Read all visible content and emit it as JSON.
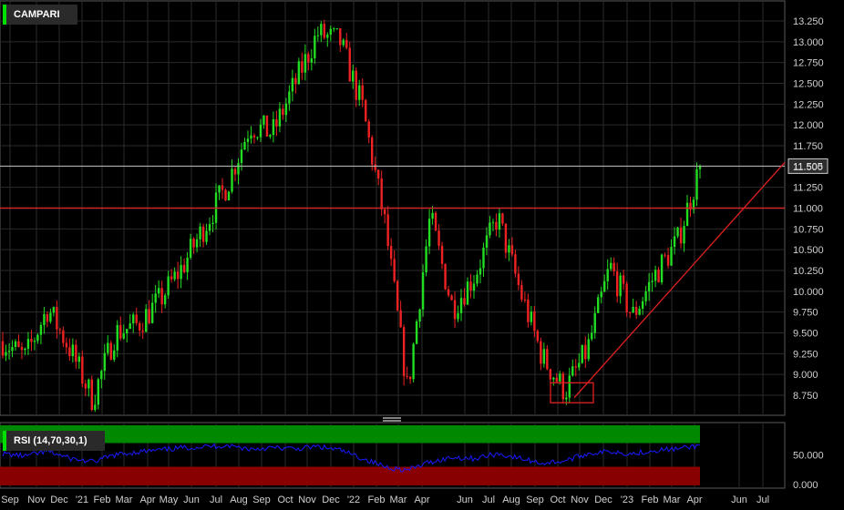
{
  "instrument": {
    "name": "CAMPARI"
  },
  "rsi": {
    "label": "RSI (14,70,30,1)"
  },
  "last_price_label": "11.505",
  "colors": {
    "background": "#000000",
    "grid": "#2b2b2b",
    "up_candle": "#22dd22",
    "down_candle": "#ee2222",
    "trendline": "#e02020",
    "rsi_line": "#1a1aff",
    "rsi_overbought_zone": "#008800",
    "rsi_oversold_zone": "#880000"
  },
  "chart_data": [
    {
      "type": "candlestick",
      "title": "CAMPARI",
      "x_tick_labels": [
        "Sep",
        "Nov",
        "Dec",
        "'21",
        "Feb",
        "Mar",
        "Apr",
        "May",
        "Jun",
        "Jul",
        "Aug",
        "Sep",
        "Oct",
        "Nov",
        "Dec",
        "'22",
        "Feb",
        "Mar",
        "Apr",
        "Jun",
        "Jul",
        "Aug",
        "Sep",
        "Oct",
        "Nov",
        "Dec",
        "'23",
        "Feb",
        "Mar",
        "Apr",
        "Jun",
        "Jul"
      ],
      "y_tick_labels": [
        "13.250",
        "13.000",
        "12.750",
        "12.500",
        "12.250",
        "12.000",
        "11.750",
        "11.500",
        "11.250",
        "11.000",
        "10.750",
        "10.500",
        "10.250",
        "10.000",
        "9.750",
        "9.500",
        "9.250",
        "9.000",
        "8.750"
      ],
      "ylim": [
        8.55,
        13.55
      ],
      "approx_close_path": [
        [
          "Sep 2020",
          9.4
        ],
        [
          "Oct 2020",
          9.2
        ],
        [
          "Nov 2020",
          9.8
        ],
        [
          "Dec 2020",
          9.3
        ],
        [
          "Jan 2021",
          8.7
        ],
        [
          "Feb 2021",
          9.5
        ],
        [
          "Mar 2021",
          9.6
        ],
        [
          "Apr 2021",
          9.9
        ],
        [
          "May 2021",
          10.3
        ],
        [
          "Jun 2021",
          10.8
        ],
        [
          "Jul 2021",
          11.3
        ],
        [
          "Aug 2021",
          12.0
        ],
        [
          "Sep 2021",
          11.9
        ],
        [
          "Oct 2021",
          12.5
        ],
        [
          "Nov 2021",
          13.1
        ],
        [
          "Dec 2021",
          13.0
        ],
        [
          "Jan 2022",
          12.2
        ],
        [
          "Feb 2022",
          10.8
        ],
        [
          "Mar 2022",
          8.8
        ],
        [
          "Apr 2022",
          10.9
        ],
        [
          "May 2022",
          9.8
        ],
        [
          "Jun 2022",
          10.2
        ],
        [
          "Jul 2022",
          10.9
        ],
        [
          "Aug 2022",
          10.0
        ],
        [
          "Sep 2022",
          9.2
        ],
        [
          "Oct 2022",
          8.8
        ],
        [
          "Nov 2022",
          9.3
        ],
        [
          "Dec 2022",
          10.3
        ],
        [
          "Jan 2023",
          9.7
        ],
        [
          "Feb 2023",
          10.2
        ],
        [
          "Mar 2023",
          10.6
        ],
        [
          "Apr 2023",
          11.5
        ]
      ],
      "last_value": 11.505,
      "horizontal_line": 11.0,
      "support_trendline": [
        [
          "Oct 2022",
          8.72
        ],
        [
          "Jul 2023",
          11.55
        ]
      ],
      "box": {
        "x_range": [
          "Oct 2022",
          "Nov 2022"
        ],
        "y_range": [
          8.66,
          8.9
        ]
      },
      "grid": true
    },
    {
      "type": "line",
      "title": "RSI (14,70,30,1)",
      "y_tick_labels": [
        "50.000",
        "0.000"
      ],
      "zones": [
        {
          "from": 70,
          "to": 100,
          "name": "overbought"
        },
        {
          "from": 0,
          "to": 30,
          "name": "oversold"
        }
      ],
      "approx_series": [
        52,
        48,
        56,
        44,
        38,
        50,
        55,
        58,
        62,
        64,
        66,
        60,
        62,
        60,
        64,
        58,
        44,
        30,
        24,
        38,
        46,
        44,
        52,
        44,
        36,
        40,
        52,
        56,
        52,
        58,
        60,
        66
      ]
    }
  ]
}
